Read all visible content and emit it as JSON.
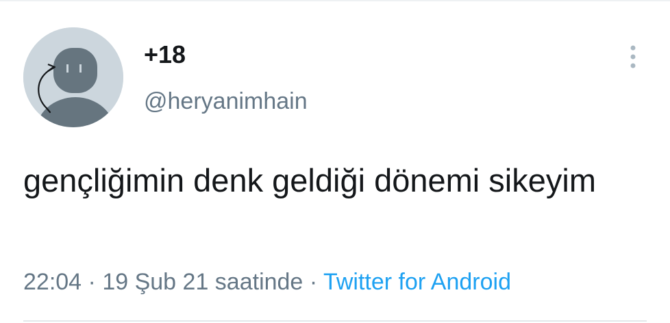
{
  "tweet": {
    "display_name": "+18",
    "handle": "@heryanimhain",
    "text": "gençliğimin denk geldiği dönemi sikeyim",
    "time": "22:04",
    "separator": "·",
    "date_suffix": "19 Şub 21 saatinde",
    "source": "Twitter for Android"
  },
  "icons": {
    "avatar": "default-egg-avatar-icon",
    "more": "vertical-ellipsis-icon"
  },
  "colors": {
    "text_primary": "#14171a",
    "text_secondary": "#657786",
    "link": "#1da1f2",
    "avatar_bg": "#ccd6dd",
    "avatar_figure": "#66757f"
  }
}
